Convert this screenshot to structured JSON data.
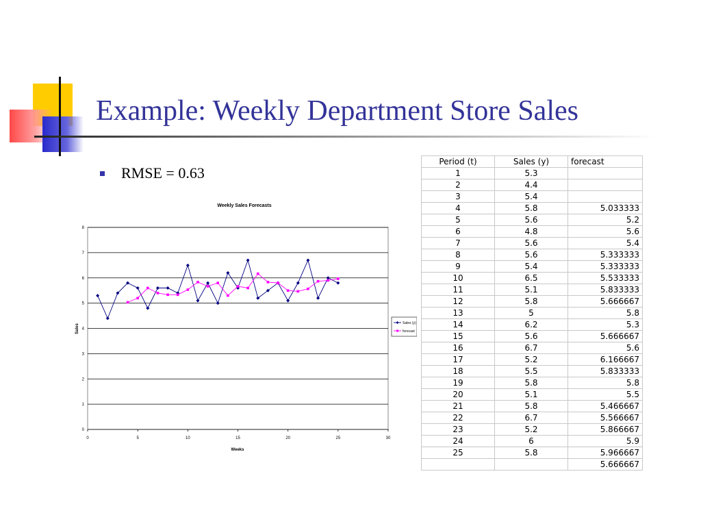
{
  "slide": {
    "title": "Example: Weekly Department Store Sales",
    "bullets": [
      "RMSE = 0.63"
    ]
  },
  "colors": {
    "title": "#333399",
    "sales_series": "#000080",
    "forecast_series": "#ff00ff",
    "accent_yellow": "#ffcc00",
    "accent_red": "#ff3333",
    "accent_blue": "#2a2acc"
  },
  "table": {
    "headers": [
      "Period (t)",
      "Sales (y)",
      "forecast"
    ],
    "rows": [
      [
        "1",
        "5.3",
        ""
      ],
      [
        "2",
        "4.4",
        ""
      ],
      [
        "3",
        "5.4",
        ""
      ],
      [
        "4",
        "5.8",
        "5.033333"
      ],
      [
        "5",
        "5.6",
        "5.2"
      ],
      [
        "6",
        "4.8",
        "5.6"
      ],
      [
        "7",
        "5.6",
        "5.4"
      ],
      [
        "8",
        "5.6",
        "5.333333"
      ],
      [
        "9",
        "5.4",
        "5.333333"
      ],
      [
        "10",
        "6.5",
        "5.533333"
      ],
      [
        "11",
        "5.1",
        "5.833333"
      ],
      [
        "12",
        "5.8",
        "5.666667"
      ],
      [
        "13",
        "5",
        "5.8"
      ],
      [
        "14",
        "6.2",
        "5.3"
      ],
      [
        "15",
        "5.6",
        "5.666667"
      ],
      [
        "16",
        "6.7",
        "5.6"
      ],
      [
        "17",
        "5.2",
        "6.166667"
      ],
      [
        "18",
        "5.5",
        "5.833333"
      ],
      [
        "19",
        "5.8",
        "5.8"
      ],
      [
        "20",
        "5.1",
        "5.5"
      ],
      [
        "21",
        "5.8",
        "5.466667"
      ],
      [
        "22",
        "6.7",
        "5.566667"
      ],
      [
        "23",
        "5.2",
        "5.866667"
      ],
      [
        "24",
        "6",
        "5.9"
      ],
      [
        "25",
        "5.8",
        "5.966667"
      ],
      [
        "",
        "",
        "5.666667"
      ]
    ]
  },
  "chart_data": {
    "type": "line",
    "title": "Weekly Sales Forecasts",
    "xlabel": "Weeks",
    "ylabel": "Sales",
    "xlim": [
      0,
      30
    ],
    "ylim": [
      0,
      8
    ],
    "xticks": [
      0,
      5,
      10,
      15,
      20,
      25,
      30
    ],
    "yticks": [
      0,
      1,
      2,
      3,
      4,
      5,
      6,
      7,
      8
    ],
    "grid": true,
    "legend_position": "right",
    "series": [
      {
        "name": "Sales (y)",
        "color": "#000080",
        "x": [
          1,
          2,
          3,
          4,
          5,
          6,
          7,
          8,
          9,
          10,
          11,
          12,
          13,
          14,
          15,
          16,
          17,
          18,
          19,
          20,
          21,
          22,
          23,
          24,
          25
        ],
        "y": [
          5.3,
          4.4,
          5.4,
          5.8,
          5.6,
          4.8,
          5.6,
          5.6,
          5.4,
          6.5,
          5.1,
          5.8,
          5,
          6.2,
          5.6,
          6.7,
          5.2,
          5.5,
          5.8,
          5.1,
          5.8,
          6.7,
          5.2,
          6,
          5.8
        ]
      },
      {
        "name": "forecast",
        "color": "#ff00ff",
        "x": [
          4,
          5,
          6,
          7,
          8,
          9,
          10,
          11,
          12,
          13,
          14,
          15,
          16,
          17,
          18,
          19,
          20,
          21,
          22,
          23,
          24,
          25
        ],
        "y": [
          5.033333,
          5.2,
          5.6,
          5.4,
          5.333333,
          5.333333,
          5.533333,
          5.833333,
          5.666667,
          5.8,
          5.3,
          5.666667,
          5.6,
          6.166667,
          5.833333,
          5.8,
          5.5,
          5.466667,
          5.566667,
          5.866667,
          5.9,
          5.966667
        ]
      }
    ]
  }
}
